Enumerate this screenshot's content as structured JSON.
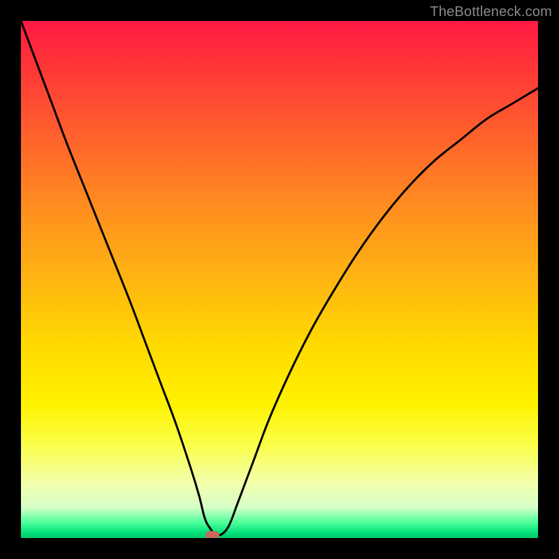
{
  "watermark": {
    "text": "TheBottleneck.com"
  },
  "colors": {
    "background": "#000000",
    "curve": "#000000",
    "marker": "#c56a5a",
    "gradient_top": "#ff1a44",
    "gradient_bottom": "#00c86a"
  },
  "chart_data": {
    "type": "line",
    "title": "",
    "xlabel": "",
    "ylabel": "",
    "xlim": [
      0,
      100
    ],
    "ylim": [
      0,
      100
    ],
    "grid": false,
    "legend": false,
    "background": "rainbow-vertical-gradient",
    "series": [
      {
        "name": "bottleneck-curve",
        "x": [
          0,
          3,
          6,
          9,
          13,
          17,
          21,
          24,
          27,
          30,
          33,
          34.5,
          35.5,
          36.5,
          38,
          40,
          42,
          45,
          48,
          52,
          56,
          60,
          65,
          70,
          75,
          80,
          85,
          90,
          95,
          100
        ],
        "y": [
          100,
          92,
          84,
          76,
          66,
          56,
          46,
          38,
          30,
          22,
          13,
          8,
          4,
          2,
          0.5,
          2,
          7,
          15,
          23,
          32,
          40,
          47,
          55,
          62,
          68,
          73,
          77,
          81,
          84,
          87
        ]
      }
    ],
    "marker": {
      "x": 37,
      "y": 0,
      "shape": "rounded-rect"
    },
    "notes": "V-shaped curve over vertical red-to-green gradient; minimum near x≈37 at the bottom edge. Left branch starts at top-left corner and descends steeply; right branch rises with decreasing slope toward upper-right but does not reach the top. No axis ticks or labels are visible."
  }
}
